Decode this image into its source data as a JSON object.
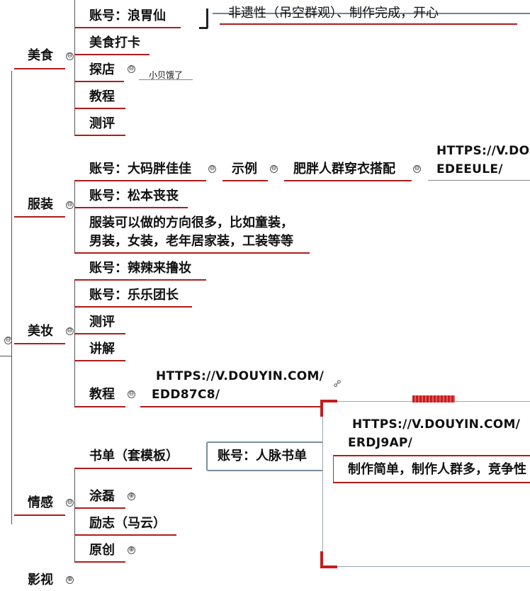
{
  "categories": {
    "food": {
      "label": "美食",
      "top_account": "账号：浪胃仙",
      "top_note": "非遗性（吊空群观）、制作完成，开心",
      "items": [
        "美食打卡",
        "探店",
        "教程",
        "测评"
      ],
      "tandian_note": "小贝饿了"
    },
    "fashion": {
      "label": "服装",
      "account1": "账号：大码胖佳佳",
      "example_label": "示例",
      "example_desc": "肥胖人群穿衣搭配",
      "example_url_1": "HTTPS://V.DO",
      "example_url_2": "EDEEULE/",
      "account2": "账号：松本丧丧",
      "desc_1": "服装可以做的方向很多，比如童装，",
      "desc_2": "男装，女装，老年居家装，工装等等"
    },
    "beauty": {
      "label": "美妆",
      "items": [
        "账号：辣辣来撸妆",
        "账号：乐乐团长",
        "测评",
        "讲解",
        "教程"
      ],
      "url_1": "HTTPS://V.DOUYIN.COM/",
      "url_2": "EDD87C8/"
    },
    "emotion": {
      "label": "情感",
      "booklist": "书单（套模板）",
      "account": "账号：人脉书单",
      "popup_url_1": "HTTPS://V.DOUYIN.COM/",
      "popup_url_2": "ERDJ9AP/",
      "popup_desc": "制作简单，制作人群多，竞争性",
      "items": [
        "涂磊",
        "励志（马云）",
        "原创"
      ]
    },
    "film": {
      "label": "影视"
    }
  },
  "toggles": {
    "collapse": "⊖",
    "expand": "⊕"
  }
}
